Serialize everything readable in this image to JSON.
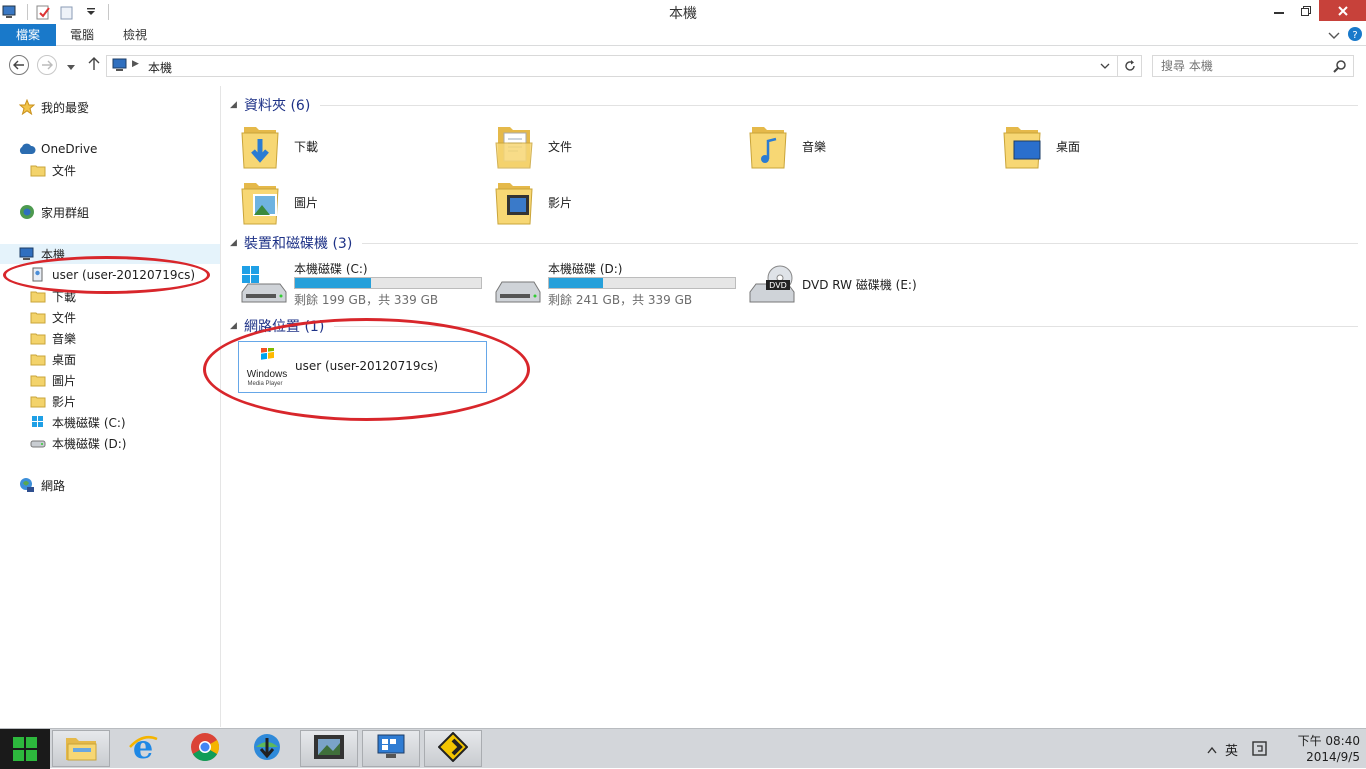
{
  "window": {
    "title": "本機"
  },
  "ribbon": {
    "tabs": [
      "檔案",
      "電腦",
      "檢視"
    ]
  },
  "address": {
    "crumb": "本機",
    "search_placeholder": "搜尋 本機"
  },
  "nav": {
    "favorites": "我的最愛",
    "onedrive": "OneDrive",
    "onedrive_docs": "文件",
    "homegroup": "家用群組",
    "thispc": "本機",
    "pc_children": [
      "user (user-20120719cs)",
      "下載",
      "文件",
      "音樂",
      "桌面",
      "圖片",
      "影片",
      "本機磁碟 (C:)",
      "本機磁碟 (D:)"
    ],
    "network": "網路"
  },
  "groups": {
    "folders": "資料夾 (6)",
    "devices": "裝置和磁碟機 (3)",
    "network": "網路位置 (1)"
  },
  "folders": [
    "下載",
    "文件",
    "音樂",
    "桌面",
    "圖片",
    "影片"
  ],
  "drives": [
    {
      "name": "本機磁碟 (C:)",
      "free": "剩餘 199 GB，共 339 GB",
      "used_fraction": 0.41
    },
    {
      "name": "本機磁碟 (D:)",
      "free": "剩餘 241 GB，共 339 GB",
      "used_fraction": 0.29
    },
    {
      "name": "DVD RW 磁碟機 (E:)"
    }
  ],
  "network_location": {
    "name": "user (user-20120719cs)",
    "logo_line1": "Windows",
    "logo_line2": "Media Player"
  },
  "taskbar": {
    "ime": "英",
    "time": "下午 08:40",
    "date": "2014/9/5"
  },
  "colors": {
    "accent": "#1979ca",
    "drive_bar": "#26a0da",
    "annotation": "#d8262b",
    "close": "#c7413a"
  }
}
